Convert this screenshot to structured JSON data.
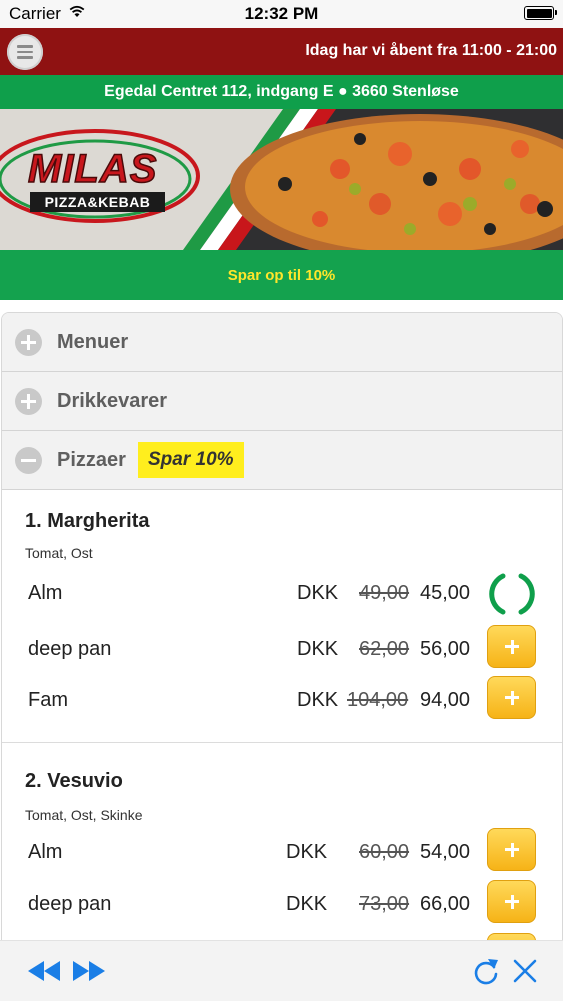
{
  "status_bar": {
    "carrier": "Carrier",
    "time": "12:32 PM"
  },
  "header": {
    "opening_hours": "Idag har vi åbent fra 11:00 - 21:00"
  },
  "address": "Egedal Centret 112, indgang E ● 3660 Stenløse",
  "banner": {
    "logo_main": "MILAS",
    "logo_sub": "PIZZA&KEBAB"
  },
  "promo_bar": "Spar op til 10%",
  "categories": [
    {
      "label": "Menuer",
      "state": "collapsed"
    },
    {
      "label": "Drikkevarer",
      "state": "collapsed"
    },
    {
      "label": "Pizzaer",
      "state": "expanded",
      "promo": "Spar 10%"
    }
  ],
  "items": [
    {
      "title": "1. Margherita",
      "description": "Tomat, Ost",
      "rows": [
        {
          "size": "Alm",
          "currency": "DKK",
          "old_price": "49,00",
          "new_price": "45,00",
          "action": "loading"
        },
        {
          "size": "deep pan",
          "currency": "DKK",
          "old_price": "62,00",
          "new_price": "56,00",
          "action": "add"
        },
        {
          "size": "Fam",
          "currency": "DKK",
          "old_price": "104,00",
          "new_price": "94,00",
          "action": "add"
        }
      ]
    },
    {
      "title": "2. Vesuvio",
      "description": "Tomat, Ost, Skinke",
      "rows": [
        {
          "size": "Alm",
          "currency": "DKK",
          "old_price": "60,00",
          "new_price": "54,00",
          "action": "add"
        },
        {
          "size": "deep pan",
          "currency": "DKK",
          "old_price": "73,00",
          "new_price": "66,00",
          "action": "add"
        }
      ]
    }
  ],
  "toolbar": {
    "icons": [
      "rewind-icon",
      "fast-forward-icon",
      "refresh-icon",
      "close-icon"
    ]
  },
  "colors": {
    "header_red": "#8f1212",
    "green": "#0f9f4b",
    "promo_yellow": "#ffee1e",
    "add_button": "#f6b317",
    "toolbar_blue": "#1a7ee6"
  }
}
